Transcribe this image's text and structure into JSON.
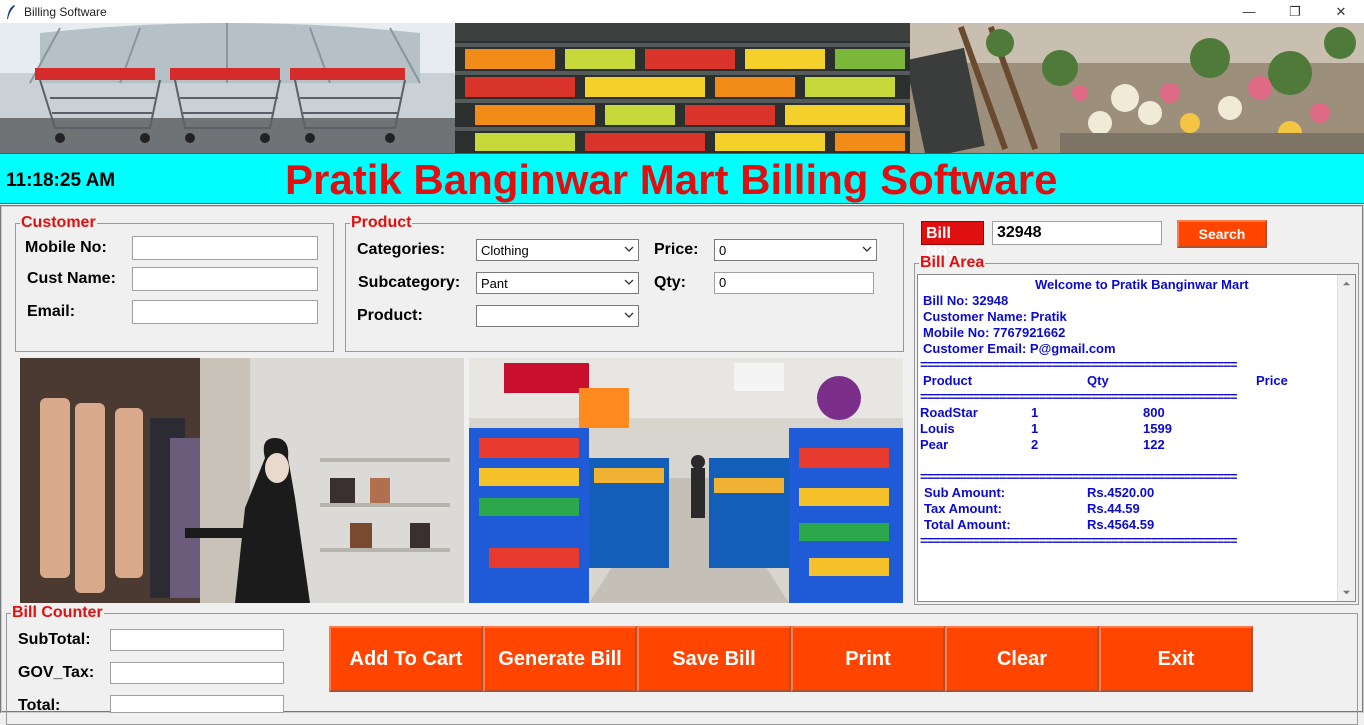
{
  "window": {
    "title": "Billing Software",
    "minimize": "—",
    "maximize": "❐",
    "close": "✕"
  },
  "header": {
    "clock": "11:18:25 AM",
    "title": "Pratik Banginwar Mart Billing Software",
    "bg_color": "#00ffff",
    "title_color": "#e01010"
  },
  "customer": {
    "legend": "Customer",
    "mobile_label": "Mobile No:",
    "mobile_value": "",
    "name_label": "Cust Name:",
    "name_value": "",
    "email_label": "Email:",
    "email_value": ""
  },
  "product": {
    "legend": "Product",
    "categories_label": "Categories:",
    "categories_value": "Clothing",
    "subcategory_label": "Subcategory:",
    "subcategory_value": "Pant",
    "product_label": "Product:",
    "product_value": "",
    "price_label": "Price:",
    "price_value": "0",
    "qty_label": "Qty:",
    "qty_value": "0"
  },
  "bill_search": {
    "label": "Bill No:",
    "value": "32948",
    "button": "Search"
  },
  "bill_area": {
    "legend": "Bill Area",
    "welcome": "Welcome to Pratik Banginwar Mart",
    "bill_no": "Bill No: 32948",
    "customer_name": "Customer Name: Pratik",
    "mobile": "Mobile No: 7767921662",
    "email": "Customer Email: P@gmail.com",
    "separator": "================================================",
    "headers": {
      "product": "Product",
      "qty": "Qty",
      "price": "Price"
    },
    "items": [
      {
        "product": "RoadStar",
        "qty": "1",
        "price": "800"
      },
      {
        "product": "Louis",
        "qty": "1",
        "price": "1599"
      },
      {
        "product": "Pear",
        "qty": "2",
        "price": "122"
      }
    ],
    "sub_label": "Sub Amount:",
    "sub_value": "Rs.4520.00",
    "tax_label": "Tax Amount:",
    "tax_value": "Rs.44.59",
    "total_label": "Total Amount:",
    "total_value": "Rs.4564.59"
  },
  "bill_counter": {
    "legend": "Bill Counter",
    "subtotal_label": "SubTotal:",
    "subtotal_value": "",
    "tax_label": "GOV_Tax:",
    "tax_value": "",
    "total_label": "Total:",
    "total_value": ""
  },
  "actions": [
    "Add To Cart",
    "Generate Bill",
    "Save Bill",
    "Print",
    "Clear",
    "Exit"
  ],
  "icons": [
    "feather-icon",
    "minimize-icon",
    "maximize-icon",
    "close-icon",
    "chevron-down-icon",
    "scroll-up-icon",
    "scroll-down-icon"
  ],
  "colors": {
    "accent_button": "#ff4500",
    "legend_text": "#e01010",
    "bill_text": "#0a0ad0"
  }
}
